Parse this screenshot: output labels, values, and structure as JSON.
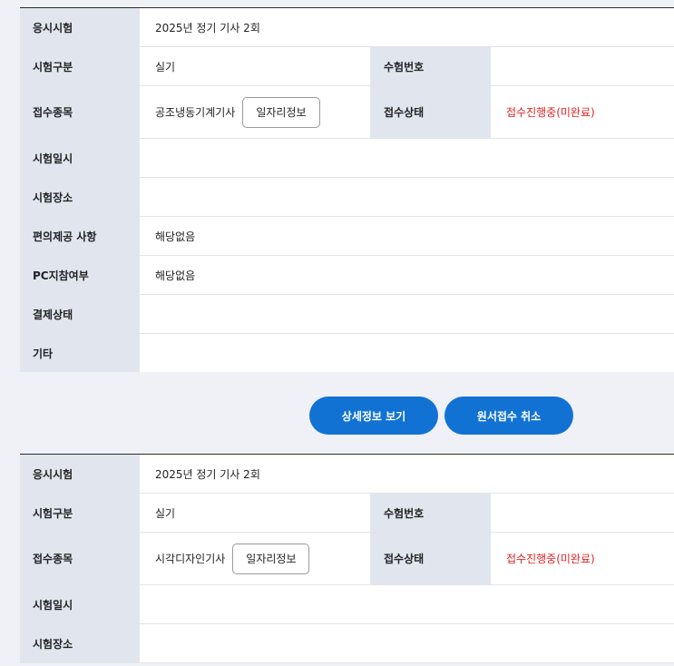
{
  "applications": [
    {
      "exam_label": "응시시험",
      "exam_value": "2025년 정기 기사 2회",
      "category_label": "시험구분",
      "category_value": "실기",
      "exam_no_label": "수험번호",
      "exam_no_value": "",
      "item_label": "접수종목",
      "item_value": "공조냉동기계기사",
      "job_button": "일자리정보",
      "status_label": "접수상태",
      "status_value": "접수진행중(미완료)",
      "datetime_label": "시험일시",
      "datetime_value": "",
      "place_label": "시험장소",
      "place_value": "",
      "convenience_label": "편의제공 사항",
      "convenience_value": "해당없음",
      "pc_label": "PC지참여부",
      "pc_value": "해당없음",
      "payment_label": "결제상태",
      "payment_value": "",
      "etc_label": "기타",
      "etc_value": ""
    },
    {
      "exam_label": "응시시험",
      "exam_value": "2025년 정기 기사 2회",
      "category_label": "시험구분",
      "category_value": "실기",
      "exam_no_label": "수험번호",
      "exam_no_value": "",
      "item_label": "접수종목",
      "item_value": "시각디자인기사",
      "job_button": "일자리정보",
      "status_label": "접수상태",
      "status_value": "접수진행중(미완료)",
      "datetime_label": "시험일시",
      "datetime_value": "",
      "place_label": "시험장소",
      "place_value": ""
    }
  ],
  "actions": {
    "detail_button": "상세정보 보기",
    "cancel_button": "원서접수 취소"
  },
  "colors": {
    "primary": "#1172d4",
    "status": "#e02424",
    "header_cell": "#e1e6ee",
    "page_bg": "#eff1f6"
  }
}
